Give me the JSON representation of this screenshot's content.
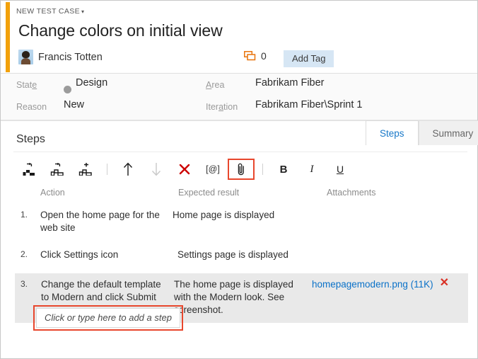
{
  "header": {
    "breadcrumb": "NEW TEST CASE",
    "breadcrumb_caret": "▾",
    "title": "Change colors on initial view",
    "assignee": "Francis Totten",
    "discussion_count": "0",
    "add_tag_label": "Add Tag",
    "accent_color": "#f2a10b"
  },
  "fields": {
    "state_label_pre": "Stat",
    "state_label_accel": "e",
    "state_value": "Design",
    "state_dot_color": "#9b9b9b",
    "reason_label": "Reason",
    "reason_value": "New",
    "area_label_accel": "A",
    "area_label_post": "rea",
    "area_value": "Fabrikam Fiber",
    "iteration_label_pre": "Iter",
    "iteration_label_accel": "a",
    "iteration_label_post": "tion",
    "iteration_value": "Fabrikam Fiber\\Sprint 1"
  },
  "tabs": [
    {
      "label": "Steps",
      "active": true
    },
    {
      "label": "Summary",
      "active": false
    }
  ],
  "panel": {
    "heading": "Steps",
    "maximize_icon": "maximize-icon",
    "collapse_icon": "chevron-up-icon"
  },
  "toolbar": {
    "items": [
      {
        "name": "insert-step-icon",
        "kind": "steps-arrow"
      },
      {
        "name": "insert-shared-step-icon",
        "kind": "steps-arrow-outline"
      },
      {
        "name": "add-step-icon",
        "kind": "steps-plus"
      },
      {
        "name": "separator-1",
        "kind": "sep"
      },
      {
        "name": "move-up-icon",
        "kind": "arrow-up"
      },
      {
        "name": "move-down-icon",
        "kind": "arrow-down",
        "disabled": true
      },
      {
        "name": "delete-step-icon",
        "kind": "x-red"
      },
      {
        "name": "insert-parameter-icon",
        "kind": "text",
        "label": "[@]"
      },
      {
        "name": "attachment-icon",
        "kind": "paperclip",
        "highlighted": true
      },
      {
        "name": "separator-2",
        "kind": "sep"
      },
      {
        "name": "bold-icon",
        "kind": "bold",
        "label": "B"
      },
      {
        "name": "italic-icon",
        "kind": "italic",
        "label": "I"
      },
      {
        "name": "underline-icon",
        "kind": "underline",
        "label": "U"
      }
    ],
    "highlight_color": "#e8472d"
  },
  "table": {
    "columns": [
      "Action",
      "Expected result",
      "Attachments"
    ],
    "rows": [
      {
        "num": "1.",
        "action": "Open the home page for the web site",
        "expected": "Home page is displayed",
        "attachment": "",
        "attachment_size": "",
        "selected": false
      },
      {
        "num": "2.",
        "action": "Click Settings icon",
        "expected": "Settings page is displayed",
        "attachment": "",
        "attachment_size": "",
        "selected": false
      },
      {
        "num": "3.",
        "action": "Change the default template to Modern and click Submit",
        "expected": "The home page is displayed with the Modern look. See screenshot.",
        "attachment": "homepagemodern.png (11K)",
        "attachment_remove": "✕",
        "selected": true
      }
    ]
  },
  "add_step": {
    "placeholder": "Click or type here to add a step"
  }
}
